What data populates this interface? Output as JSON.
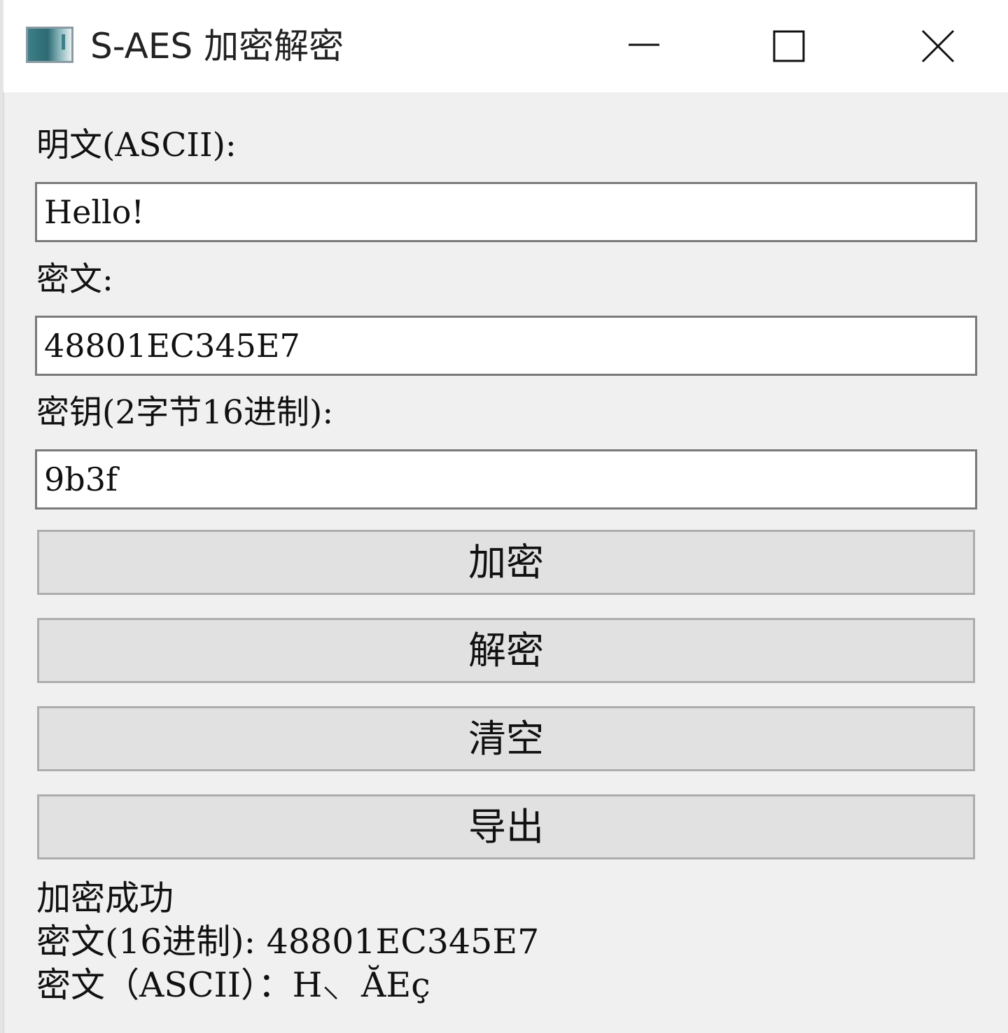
{
  "window": {
    "title": "S-AES 加密解密",
    "icons": [
      "app-icon",
      "minimize-icon",
      "maximize-icon",
      "close-icon"
    ]
  },
  "form": {
    "plaintext_label": "明文(ASCII):",
    "plaintext_value": "Hello!",
    "ciphertext_label": "密文:",
    "ciphertext_value": "48801EC345E7",
    "key_label": "密钥(2字节16进制):",
    "key_value": "9b3f"
  },
  "buttons": {
    "encrypt": "加密",
    "decrypt": "解密",
    "clear": "清空",
    "export": "导出"
  },
  "status": {
    "line1": "加密成功",
    "line2": "密文(16进制): 48801EC345E7",
    "line3": "密文（ASCII）：H⸜  ĂEç"
  },
  "colors": {
    "window_bg": "#f0f0f0",
    "titlebar_bg": "#ffffff",
    "button_bg": "#e1e1e1",
    "field_border": "#7a7a7a"
  }
}
